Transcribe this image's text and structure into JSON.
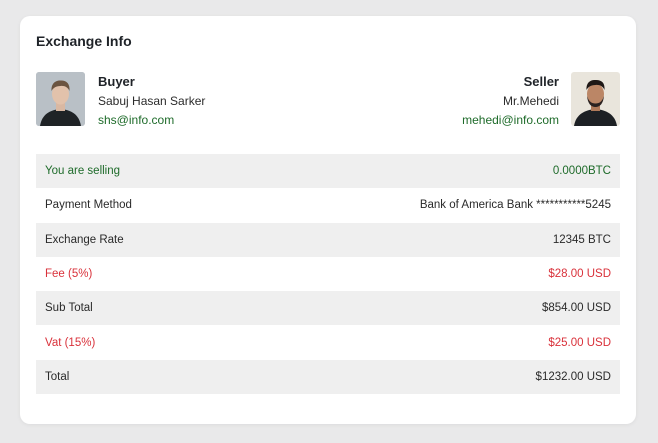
{
  "title": "Exchange Info",
  "buyer": {
    "role": "Buyer",
    "name": "Sabuj Hasan Sarker",
    "email": "shs@info.com"
  },
  "seller": {
    "role": "Seller",
    "name": "Mr.Mehedi",
    "email": "mehedi@info.com"
  },
  "rows": [
    {
      "label": "You are selling",
      "value": "0.0000BTC"
    },
    {
      "label": "Payment Method",
      "value": "Bank of America Bank ***********5245"
    },
    {
      "label": "Exchange Rate",
      "value": "12345 BTC"
    },
    {
      "label": "Fee (5%)",
      "value": "$28.00 USD"
    },
    {
      "label": "Sub Total",
      "value": "$854.00 USD"
    },
    {
      "label": "Vat (15%)",
      "value": "$25.00 USD"
    },
    {
      "label": "Total",
      "value": "$1232.00 USD"
    }
  ],
  "colors": {
    "green": "#1e6b2a",
    "red": "#d9313a",
    "row_shade": "#efefef"
  }
}
